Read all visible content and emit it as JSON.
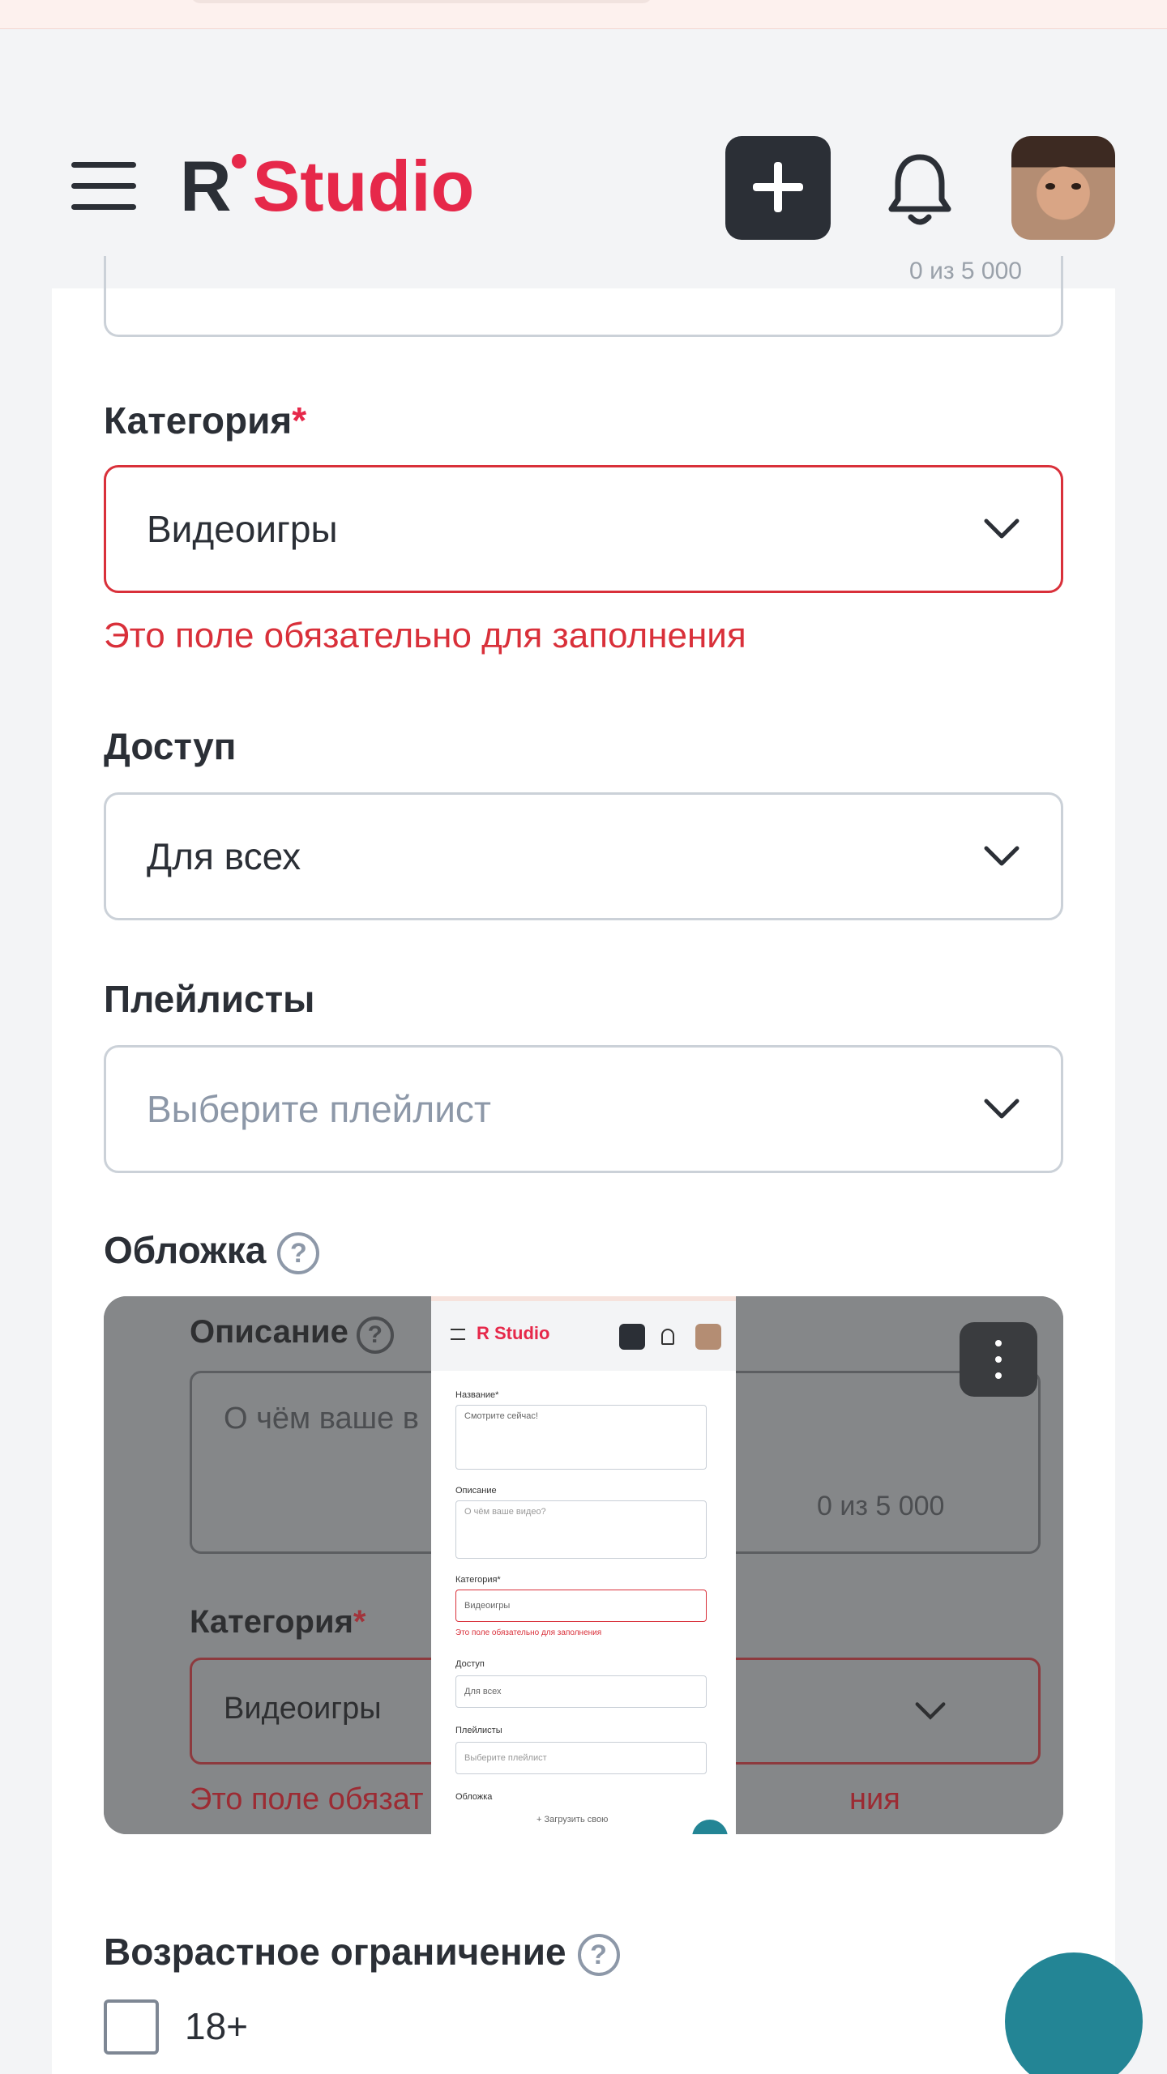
{
  "header": {
    "logo_prefix": "R",
    "logo_brand": "Studio"
  },
  "form": {
    "top_field_counter": "0 из 5 000",
    "category": {
      "label": "Категория",
      "required_mark": "*",
      "value": "Видеоигры",
      "error": "Это поле обязательно для заполнения"
    },
    "access": {
      "label": "Доступ",
      "value": "Для всех"
    },
    "playlists": {
      "label": "Плейлисты",
      "placeholder": "Выберите плейлист"
    },
    "cover": {
      "label": "Обложка",
      "help": "?",
      "preview_description_label": "Описание",
      "preview_description_placeholder": "О чём ваше в",
      "preview_counter": "0 из 5 000",
      "preview_category_label": "Категория",
      "preview_category_value": "Видеоигры",
      "preview_error_left": "Это поле обязат",
      "preview_error_right": "ния",
      "thumb": {
        "brand": "R Studio",
        "name_label": "Название*",
        "name_value": "Смотрите сейчас!",
        "desc_label": "Описание",
        "desc_placeholder": "О чём ваше видео?",
        "cat_label": "Категория*",
        "cat_value": "Видеоигры",
        "cat_error": "Это поле обязательно для заполнения",
        "access_label": "Доступ",
        "access_value": "Для всех",
        "playlist_label": "Плейлисты",
        "playlist_value": "Выберите плейлист",
        "cover_label": "Обложка",
        "upload": "+ Загрузить свою"
      }
    },
    "age": {
      "label": "Возрастное ограничение",
      "help": "?",
      "option": "18+"
    }
  }
}
